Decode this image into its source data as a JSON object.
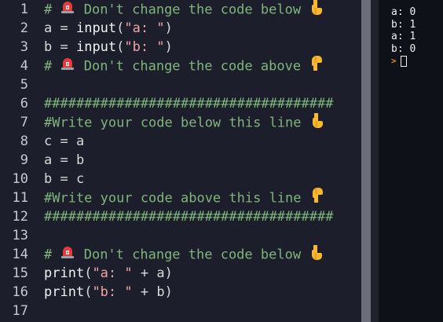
{
  "editor": {
    "lines": [
      {
        "n": "1",
        "tokens": [
          {
            "t": "# ",
            "c": "cm"
          },
          {
            "e": "siren"
          },
          {
            "t": " Don't change the code below ",
            "c": "cm"
          },
          {
            "e": "point-down"
          }
        ]
      },
      {
        "n": "2",
        "tokens": [
          {
            "t": "a ",
            "c": "op"
          },
          {
            "t": "= ",
            "c": "op"
          },
          {
            "t": "input",
            "c": "fn"
          },
          {
            "t": "(",
            "c": "op"
          },
          {
            "t": "\"a: \"",
            "c": "str"
          },
          {
            "t": ")",
            "c": "op"
          }
        ]
      },
      {
        "n": "3",
        "tokens": [
          {
            "t": "b ",
            "c": "op"
          },
          {
            "t": "= ",
            "c": "op"
          },
          {
            "t": "input",
            "c": "fn"
          },
          {
            "t": "(",
            "c": "op"
          },
          {
            "t": "\"b: \"",
            "c": "str"
          },
          {
            "t": ")",
            "c": "op"
          }
        ]
      },
      {
        "n": "4",
        "tokens": [
          {
            "t": "# ",
            "c": "cm"
          },
          {
            "e": "siren"
          },
          {
            "t": " Don't change the code above ",
            "c": "cm"
          },
          {
            "e": "point-up"
          }
        ]
      },
      {
        "n": "5",
        "tokens": []
      },
      {
        "n": "6",
        "tokens": [
          {
            "t": "####################################",
            "c": "cm"
          }
        ]
      },
      {
        "n": "7",
        "tokens": [
          {
            "t": "#Write your code below this line ",
            "c": "cm"
          },
          {
            "e": "point-down"
          }
        ]
      },
      {
        "n": "8",
        "tokens": [
          {
            "t": "c = a",
            "c": "op"
          }
        ]
      },
      {
        "n": "9",
        "tokens": [
          {
            "t": "a = b",
            "c": "op"
          }
        ]
      },
      {
        "n": "10",
        "tokens": [
          {
            "t": "b = c",
            "c": "op"
          }
        ]
      },
      {
        "n": "11",
        "tokens": [
          {
            "t": "#Write your code above this line ",
            "c": "cm"
          },
          {
            "e": "point-up"
          }
        ]
      },
      {
        "n": "12",
        "tokens": [
          {
            "t": "####################################",
            "c": "cm"
          }
        ]
      },
      {
        "n": "13",
        "tokens": []
      },
      {
        "n": "14",
        "tokens": [
          {
            "t": "# ",
            "c": "cm"
          },
          {
            "e": "siren"
          },
          {
            "t": " Don't change the code below ",
            "c": "cm"
          },
          {
            "e": "point-down"
          }
        ]
      },
      {
        "n": "15",
        "tokens": [
          {
            "t": "print",
            "c": "fn"
          },
          {
            "t": "(",
            "c": "op"
          },
          {
            "t": "\"a: \"",
            "c": "str"
          },
          {
            "t": " + a)",
            "c": "op"
          }
        ]
      },
      {
        "n": "16",
        "tokens": [
          {
            "t": "print",
            "c": "fn"
          },
          {
            "t": "(",
            "c": "op"
          },
          {
            "t": "\"b: \"",
            "c": "str"
          },
          {
            "t": " + b)",
            "c": "op"
          }
        ]
      },
      {
        "n": "17",
        "tokens": []
      }
    ]
  },
  "console": {
    "lines": [
      "a: 0",
      "b: 1",
      "a: 1",
      "b: 0"
    ],
    "prompt_symbol": ">"
  },
  "colors": {
    "editor_bg": "#1c1f2b",
    "comment": "#7fb57a",
    "string": "#f0a4a4",
    "console_bg": "#0f1118",
    "prompt": "#f08a24"
  }
}
